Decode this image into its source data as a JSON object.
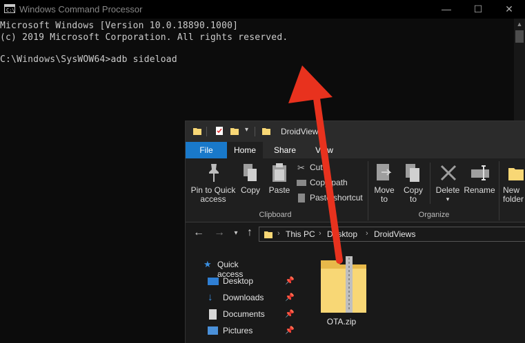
{
  "cmd": {
    "title": "Windows Command Processor",
    "icon": "cmd-icon",
    "lines": [
      "Microsoft Windows [Version 10.0.18890.1000]",
      "(c) 2019 Microsoft Corporation. All rights reserved.",
      "",
      "C:\\Windows\\SysWOW64>adb sideload"
    ],
    "window_buttons": {
      "minimize": "—",
      "maximize": "☐",
      "close": "✕"
    }
  },
  "explorer": {
    "title": "DroidViews",
    "tabs": [
      "File",
      "Home",
      "Share",
      "View"
    ],
    "ribbon": {
      "pin": [
        "Pin to Quick",
        "access"
      ],
      "copy": "Copy",
      "paste": "Paste",
      "cut": "Cut",
      "copy_path": "Copy path",
      "paste_shortcut": "Paste shortcut",
      "clipboard": "Clipboard",
      "move_to": [
        "Move",
        "to"
      ],
      "copy_to": [
        "Copy",
        "to"
      ],
      "delete": "Delete",
      "rename": "Rename",
      "organize": "Organize",
      "new_folder": [
        "New",
        "folder"
      ]
    },
    "address": [
      "This PC",
      "Desktop",
      "DroidViews"
    ],
    "nav": {
      "quick_access": "Quick access",
      "items": [
        "Desktop",
        "Downloads",
        "Documents",
        "Pictures"
      ]
    },
    "file": {
      "name": "OTA.zip"
    }
  },
  "colors": {
    "accent": "#1979ca",
    "arrow": "#e8321e",
    "folder": "#f8d775"
  }
}
